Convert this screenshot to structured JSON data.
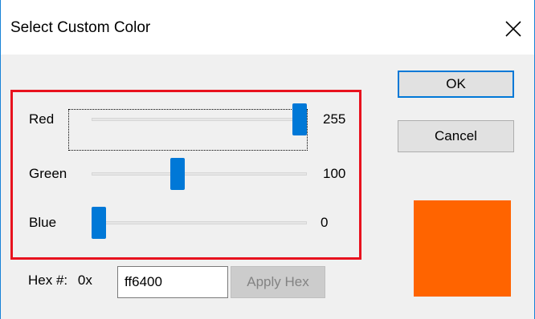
{
  "window": {
    "title": "Select Custom Color"
  },
  "buttons": {
    "ok": "OK",
    "cancel": "Cancel",
    "apply_hex": "Apply Hex"
  },
  "sliders": [
    {
      "label": "Red",
      "value": "255",
      "fraction": 1.0
    },
    {
      "label": "Green",
      "value": "100",
      "fraction": 0.392
    },
    {
      "label": "Blue",
      "value": "0",
      "fraction": 0.0
    }
  ],
  "hex": {
    "label": "Hex #:",
    "prefix": "0x",
    "value": "ff6400"
  },
  "preview": {
    "color": "#ff6400"
  },
  "colors": {
    "accent": "#0078d7",
    "highlight": "#e8121e"
  },
  "icons": {
    "close": "close-icon"
  }
}
